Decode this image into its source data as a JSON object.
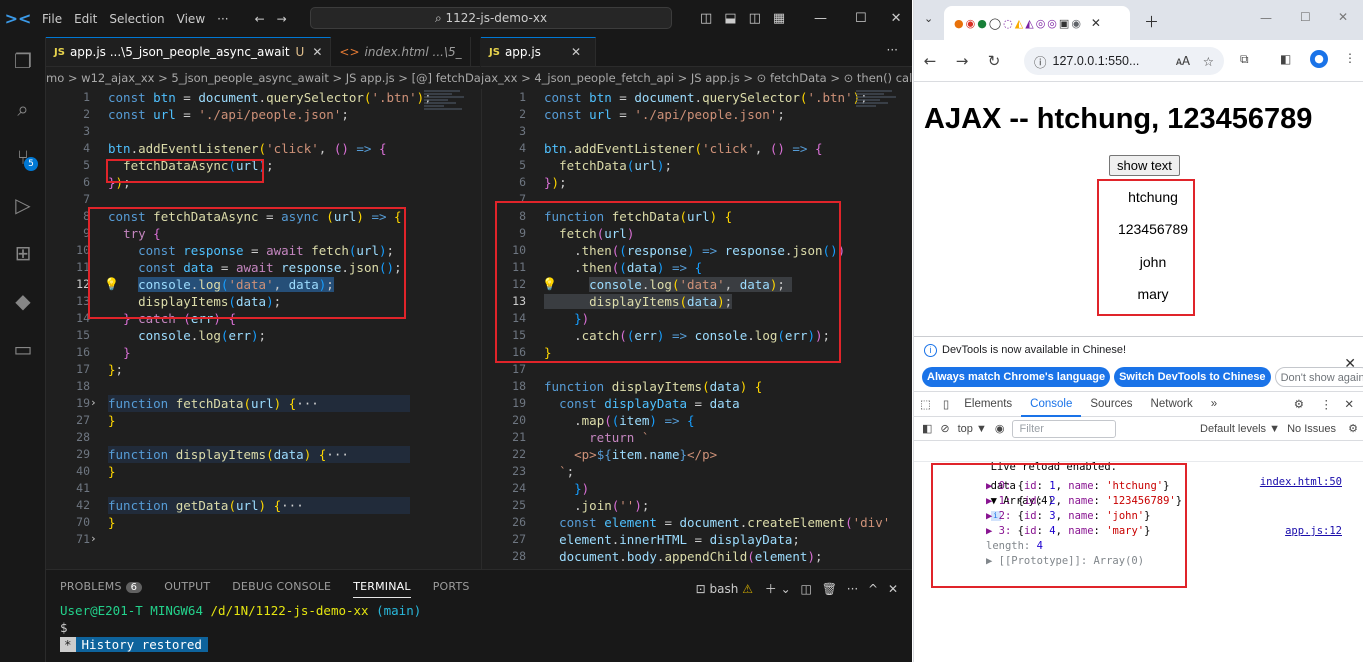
{
  "vscode": {
    "menu": [
      "File",
      "Edit",
      "Selection",
      "View",
      "···"
    ],
    "command_center": "1122-js-demo-xx",
    "left_tabs": [
      {
        "icon": "JS",
        "label": "app.js ...\\5_json_people_async_await",
        "status": "U"
      },
      {
        "icon": "<>",
        "label": "index.html ...\\5_"
      }
    ],
    "right_tabs": [
      {
        "icon": "JS",
        "label": "app.js"
      }
    ],
    "left_breadcrumb": "mo > w12_ajax_xx > 5_json_people_async_await > JS app.js > [@] fetchDataAsync",
    "right_breadcrumb": "jax_xx > 4_json_people_fetch_api > JS app.js > ⊙ fetchData > ⊙ then() callback",
    "left_line_numbers": [
      "1",
      "2",
      "3",
      "4",
      "5",
      "6",
      "7",
      "8",
      "9",
      "10",
      "11",
      "12",
      "13",
      "14",
      "15",
      "16",
      "17",
      "18",
      "19",
      "27",
      "28",
      "29",
      "40",
      "41",
      "42",
      "70",
      "71"
    ],
    "right_line_numbers": [
      "1",
      "2",
      "3",
      "4",
      "5",
      "6",
      "7",
      "8",
      "9",
      "10",
      "11",
      "12",
      "13",
      "14",
      "15",
      "16",
      "17",
      "18",
      "19",
      "20",
      "21",
      "22",
      "23",
      "24",
      "25",
      "26",
      "27",
      "28"
    ],
    "panel": {
      "tabs": [
        "PROBLEMS",
        "OUTPUT",
        "DEBUG CONSOLE",
        "TERMINAL",
        "PORTS"
      ],
      "problems_count": "6",
      "terminal_shell": "bash",
      "prompt_user": "User@E201-T MINGW64",
      "prompt_path": "/d/1N/1122-js-demo-xx",
      "prompt_branch": "(main)",
      "prompt_symbol": "$",
      "history_restored": "History restored"
    }
  },
  "chrome": {
    "url": "127.0.0.1:550...",
    "page": {
      "title": "AJAX -- htchung, 123456789",
      "button": "show text",
      "items": [
        "htchung",
        "123456789",
        "john",
        "mary"
      ]
    },
    "devtools": {
      "info": "DevTools is now available in Chinese!",
      "btn_match": "Always match Chrome's language",
      "btn_switch": "Switch DevTools to Chinese",
      "btn_dont": "Don't show again",
      "tabs": [
        "Elements",
        "Console",
        "Sources",
        "Network",
        "»"
      ],
      "context": "top ▼",
      "filter_placeholder": "Filter",
      "levels": "Default levels ▼",
      "issues": "No Issues",
      "log1": "Live reload enabled.",
      "log1_src": "index.html:50",
      "log2_prefix": "data",
      "log2_array": "▼ Array(4)",
      "log2_src": "app.js:12",
      "entries": [
        {
          "idx": "▶ 0:",
          "id": "1",
          "name": "'htchung'"
        },
        {
          "idx": "▶ 1:",
          "id": "2",
          "name": "'123456789'"
        },
        {
          "idx": "▶ 2:",
          "id": "3",
          "name": "'john'"
        },
        {
          "idx": "▶ 3:",
          "id": "4",
          "name": "'mary'"
        }
      ],
      "length_label": "length:",
      "length_val": "4",
      "proto": "▶ [[Prototype]]: Array(0)"
    }
  }
}
